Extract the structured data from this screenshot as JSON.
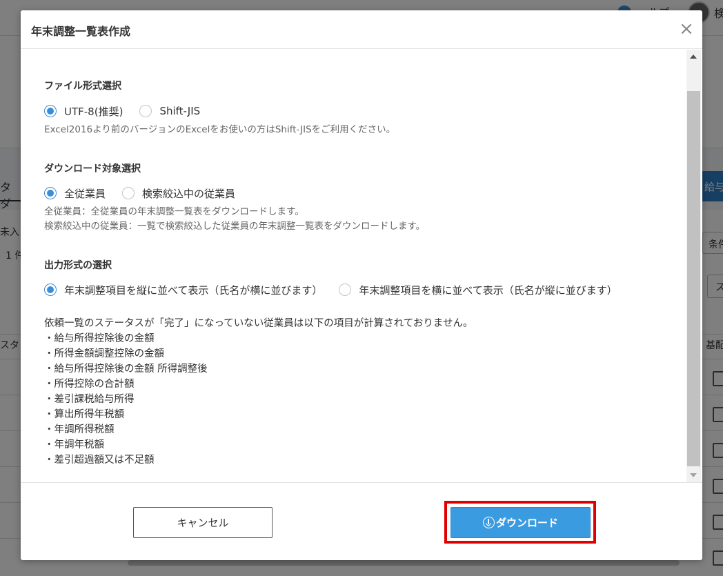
{
  "background": {
    "help_text": "ルプ",
    "user_initial": "検",
    "tab_label": "タダ",
    "blue_button": "給与",
    "unsubmitted": "未入",
    "count": "1 件",
    "condition": "条件",
    "status_col": "スタ",
    "select_value": "ス",
    "basic_col": "基配"
  },
  "modal": {
    "title": "年末調整一覧表作成",
    "close_icon": "close-icon"
  },
  "file_format": {
    "title": "ファイル形式選択",
    "options": [
      {
        "label": "UTF-8(推奨)",
        "checked": true
      },
      {
        "label": "Shift-JIS",
        "checked": false
      }
    ],
    "note": "Excel2016より前のバージョンのExcelをお使いの方はShift-JISをご利用ください。"
  },
  "download_target": {
    "title": "ダウンロード対象選択",
    "options": [
      {
        "label": "全従業員",
        "checked": true
      },
      {
        "label": "検索絞込中の従業員",
        "checked": false
      }
    ],
    "notes": [
      "全従業員：全従業員の年末調整一覧表をダウンロードします。",
      "検索絞込中の従業員：一覧で検索絞込した従業員の年末調整一覧表をダウンロードします。"
    ]
  },
  "output_format": {
    "title": "出力形式の選択",
    "options": [
      {
        "label": "年末調整項目を縦に並べて表示（氏名が横に並びます）",
        "checked": true
      },
      {
        "label": "年末調整項目を横に並べて表示（氏名が縦に並びます）",
        "checked": false
      }
    ]
  },
  "info": {
    "intro": "依頼一覧のステータスが「完了」になっていない従業員は以下の項目が計算されておりません。",
    "items": [
      "・給与所得控除後の金額",
      "・所得金額調整控除の金額",
      "・給与所得控除後の金額 所得調整後",
      "・所得控除の合計額",
      "・差引課税給与所得",
      "・算出所得年税額",
      "・年調所得税額",
      "・年調年税額",
      "・差引超過額又は不足額"
    ]
  },
  "footer": {
    "cancel_label": "キャンセル",
    "download_label": "ダウンロード",
    "download_icon": "download-circle-icon",
    "highlight_color": "#e00000",
    "accent_color": "#3b9be0"
  }
}
